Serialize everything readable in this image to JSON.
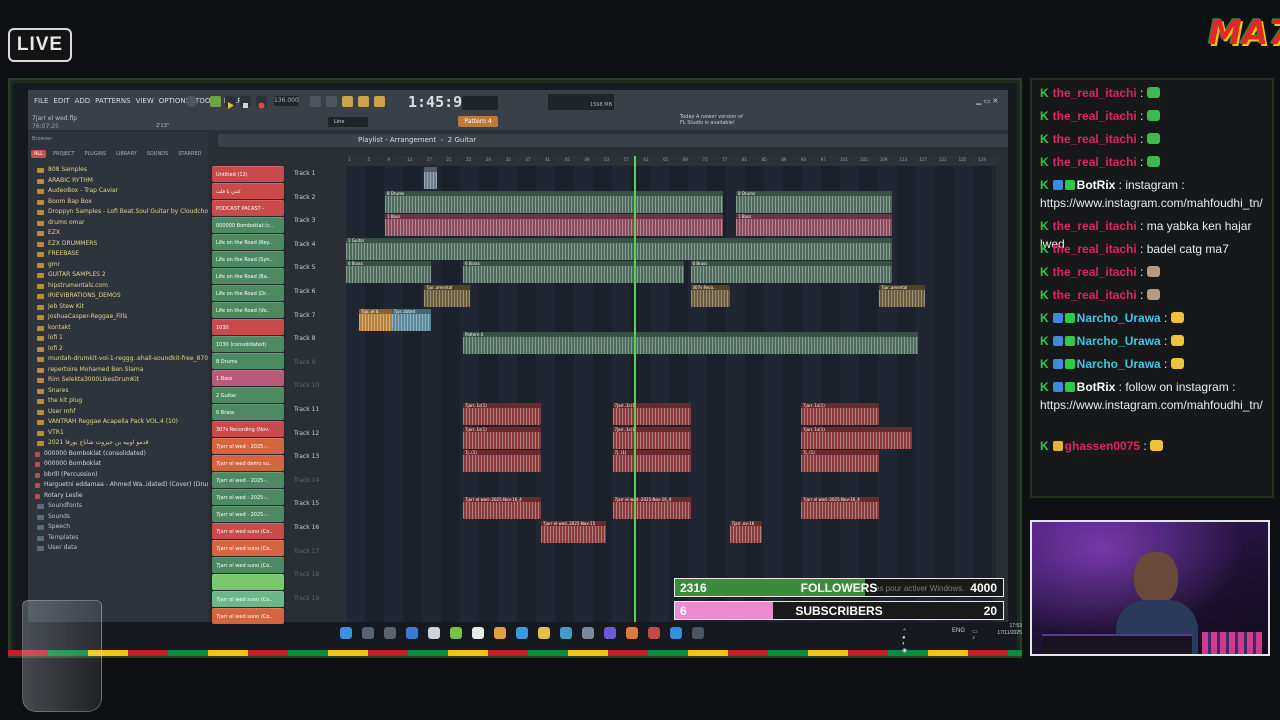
{
  "overlay": {
    "live_label": "LIVE",
    "brand_label": "MA7"
  },
  "fl": {
    "menu": [
      "FILE",
      "EDIT",
      "ADD",
      "PATTERNS",
      "VIEW",
      "OPTIONS",
      "TOOLS",
      "HELP"
    ],
    "file_name": "7jarr el wed.flp",
    "file_time": "76:07:25",
    "file_time_right": "2'13\"",
    "clock": "1:45:97",
    "bpm": "136.000",
    "mode": "Line",
    "pattern_label": "Pattern 4",
    "ram_label": "1598 MB",
    "update_hint": [
      "Today  A newer version of",
      "FL Studio is available!"
    ],
    "browser_label": "Browser",
    "browser_tabs": [
      "ALL",
      "PROJECT",
      "PLUGINS",
      "LIBRARY",
      "SOUNDS",
      "STARRED"
    ],
    "playlist_title": "Playlist - Arrangement",
    "playlist_pattern": "2 Guitar"
  },
  "browser_items": [
    {
      "label": "808 Samples",
      "kind": "folder"
    },
    {
      "label": "ARABIC RYTHM",
      "kind": "folder"
    },
    {
      "label": "AudeoBox - Trap Caviar",
      "kind": "folder"
    },
    {
      "label": "Boom Bap Box",
      "kind": "folder"
    },
    {
      "label": "Droppyn Samples - Lofi Beat.Soul Guitar by Cloudchord",
      "kind": "folder"
    },
    {
      "label": "drums omar",
      "kind": "folder"
    },
    {
      "label": "EZX",
      "kind": "folder"
    },
    {
      "label": "EZX DRUMMERS",
      "kind": "folder"
    },
    {
      "label": "FREEBASE",
      "kind": "folder"
    },
    {
      "label": "gmr",
      "kind": "folder"
    },
    {
      "label": "GUITAR SAMPLES 2",
      "kind": "folder"
    },
    {
      "label": "hipstrumentals.com",
      "kind": "folder"
    },
    {
      "label": "IRIEVIBRATIONS_DEMOS",
      "kind": "folder"
    },
    {
      "label": "Jeb Stew Kit",
      "kind": "folder"
    },
    {
      "label": "JoshuaCasper-Reggae_Fills",
      "kind": "folder"
    },
    {
      "label": "kontakt",
      "kind": "folder"
    },
    {
      "label": "lofi 1",
      "kind": "folder"
    },
    {
      "label": "lofi 2",
      "kind": "folder"
    },
    {
      "label": "murdah-drumkit-vol-1-reggg..ehall-soundkit-free_87024",
      "kind": "folder"
    },
    {
      "label": "repertoire Mohamed Ben Slama",
      "kind": "folder"
    },
    {
      "label": "Rim Selekta3000LikesDrumKit",
      "kind": "folder"
    },
    {
      "label": "Snares",
      "kind": "folder"
    },
    {
      "label": "the kit plug",
      "kind": "folder"
    },
    {
      "label": "User mhf",
      "kind": "folder"
    },
    {
      "label": "VANTRAH Reggae Acapella Pack VOL.4 (10)",
      "kind": "folder"
    },
    {
      "label": "VTR1",
      "kind": "folder"
    },
    {
      "label": "قدمو اوبيه بن جيزوت شاباج يورفا 2021",
      "kind": "folder"
    },
    {
      "label": "000000 Bomboklat (consolidated)",
      "kind": "sub"
    },
    {
      "label": "000000 Bomboklat",
      "kind": "sub"
    },
    {
      "label": "bbrlll (Percussion)",
      "kind": "sub"
    },
    {
      "label": "Harguetni eddamaa - Ahmed Wa..idated) (Cover) (Drums) (1)",
      "kind": "sub"
    },
    {
      "label": "Rotary Leslie",
      "kind": "sub"
    },
    {
      "label": "Soundfonts",
      "kind": "root"
    },
    {
      "label": "Sounds",
      "kind": "root"
    },
    {
      "label": "Speech",
      "kind": "root"
    },
    {
      "label": "Templates",
      "kind": "root"
    },
    {
      "label": "User data",
      "kind": "root"
    }
  ],
  "channels": [
    {
      "label": "Untitled (12)",
      "color": "#c94a4a"
    },
    {
      "label": "كنتي يا قلب",
      "color": "#c94a4a"
    },
    {
      "label": "PODCAST PACAST -",
      "color": "#c94a4a"
    },
    {
      "label": "000000 Bomboklat (c..",
      "color": "#4d8a62"
    },
    {
      "label": "Life on the Road (Key..",
      "color": "#4d8a62"
    },
    {
      "label": "Life on the Road (Syn..",
      "color": "#4d8a62"
    },
    {
      "label": "Life on the Road (Ba..",
      "color": "#4d8a62"
    },
    {
      "label": "Life on the Road (Dr..",
      "color": "#4d8a62"
    },
    {
      "label": "Life on the Road (Vo..",
      "color": "#4d8a62"
    },
    {
      "label": "1030",
      "color": "#c94a4a"
    },
    {
      "label": "1030 (consolidated)",
      "color": "#4d8a62"
    },
    {
      "label": "8 Drums",
      "color": "#4d8a62"
    },
    {
      "label": "1 Bass",
      "color": "#b85a7a"
    },
    {
      "label": "2 Guitar",
      "color": "#4d8a62"
    },
    {
      "label": "6 Brass",
      "color": "#4d8a62"
    },
    {
      "label": "307s Recording (Nov..",
      "color": "#c94a4a"
    },
    {
      "label": "7jarr el wed - 2025-..",
      "color": "#d4653e"
    },
    {
      "label": "7jarr el wed demo su..",
      "color": "#d4653e"
    },
    {
      "label": "7jarr el wed - 2025-..",
      "color": "#4d8a62"
    },
    {
      "label": "7jarr el wed - 2025-..",
      "color": "#4d8a62"
    },
    {
      "label": "7jarr el wed - 2025-..",
      "color": "#4d8a62"
    },
    {
      "label": "7jarr el wed suno (Co..",
      "color": "#c94a4a"
    },
    {
      "label": "7jarr el wed suno (Co..",
      "color": "#d4653e"
    },
    {
      "label": "7jarr el wed suno (Co..",
      "color": "#4d8a62"
    },
    {
      "label": "",
      "color": "#76c86a"
    },
    {
      "label": "7jarr el wed suno (Co..",
      "color": "#6ab88a"
    },
    {
      "label": "7jarr el wed suno (Co..",
      "color": "#d4653e"
    }
  ],
  "tracks": [
    "Track 1",
    "Track 2",
    "Track 3",
    "Track 4",
    "Track 5",
    "Track 6",
    "Track 7",
    "Track 8",
    "Track 9",
    "Track 10",
    "Track 11",
    "Track 12",
    "Track 13",
    "Track 14",
    "Track 15",
    "Track 16",
    "Track 17",
    "Track 18",
    "Track 19"
  ],
  "ruler_ticks": [
    "1",
    "5",
    "9",
    "13",
    "17",
    "21",
    "25",
    "29",
    "33",
    "37",
    "41",
    "45",
    "49",
    "53",
    "57",
    "61",
    "65",
    "69",
    "73",
    "77",
    "81",
    "85",
    "89",
    "93",
    "97",
    "101",
    "105",
    "109",
    "113",
    "117",
    "121",
    "125",
    "129"
  ],
  "clips": [
    {
      "track": 1,
      "start": 0.12,
      "len": 0.02,
      "label": "",
      "color": "#6b7c8a"
    },
    {
      "track": 2,
      "start": 0.06,
      "len": 0.52,
      "label": "8 Drums",
      "color": "#4d6b5c"
    },
    {
      "track": 2,
      "start": 0.6,
      "len": 0.24,
      "label": "8 Drums",
      "color": "#4d6b5c"
    },
    {
      "track": 3,
      "start": 0.06,
      "len": 0.52,
      "label": "1 Bass",
      "color": "#8a4a5c"
    },
    {
      "track": 3,
      "start": 0.6,
      "len": 0.24,
      "label": "1 Bass",
      "color": "#8a4a5c"
    },
    {
      "track": 4,
      "start": 0.0,
      "len": 0.84,
      "label": "2 Guitar",
      "color": "#4d6b5c"
    },
    {
      "track": 5,
      "start": 0.0,
      "len": 0.13,
      "label": "6 Brass",
      "color": "#4d6b5c"
    },
    {
      "track": 5,
      "start": 0.18,
      "len": 0.34,
      "label": "6 Brass",
      "color": "#4d6b5c"
    },
    {
      "track": 5,
      "start": 0.53,
      "len": 0.31,
      "label": "6 Brass",
      "color": "#4d6b5c"
    },
    {
      "track": 6,
      "start": 0.12,
      "len": 0.07,
      "label": "7jar..amental",
      "color": "#6b5a3a"
    },
    {
      "track": 6,
      "start": 0.53,
      "len": 0.06,
      "label": "307s Reco..",
      "color": "#6b5a3a"
    },
    {
      "track": 6,
      "start": 0.82,
      "len": 0.07,
      "label": "7jar..amental",
      "color": "#6b5a3a"
    },
    {
      "track": 7,
      "start": 0.02,
      "len": 0.05,
      "label": "7jar..el d.",
      "color": "#b8803a"
    },
    {
      "track": 7,
      "start": 0.07,
      "len": 0.06,
      "label": "7jar..dated",
      "color": "#5a8a9a"
    },
    {
      "track": 8,
      "start": 0.18,
      "len": 0.7,
      "label": "Pattern 4",
      "color": "#4d6b5c"
    },
    {
      "track": 11,
      "start": 0.18,
      "len": 0.12,
      "label": "7jarr..1s(1)",
      "color": "#8a3a3a"
    },
    {
      "track": 11,
      "start": 0.41,
      "len": 0.12,
      "label": "7jarr..1s(1)",
      "color": "#8a3a3a"
    },
    {
      "track": 11,
      "start": 0.7,
      "len": 0.12,
      "label": "7jarr..1s(1)",
      "color": "#8a3a3a"
    },
    {
      "track": 12,
      "start": 0.18,
      "len": 0.12,
      "label": "7jarr..1s(1)",
      "color": "#8a3a3a"
    },
    {
      "track": 12,
      "start": 0.41,
      "len": 0.12,
      "label": "7jarr..1s(1)",
      "color": "#8a3a3a"
    },
    {
      "track": 12,
      "start": 0.7,
      "len": 0.17,
      "label": "7jarr..1s(1)",
      "color": "#8a3a3a"
    },
    {
      "track": 13,
      "start": 0.18,
      "len": 0.12,
      "label": "7j..(1)",
      "color": "#8a3a3a"
    },
    {
      "track": 13,
      "start": 0.41,
      "len": 0.12,
      "label": "7j..(1)",
      "color": "#8a3a3a"
    },
    {
      "track": 13,
      "start": 0.7,
      "len": 0.12,
      "label": "7j..(1)",
      "color": "#8a3a3a"
    },
    {
      "track": 15,
      "start": 0.18,
      "len": 0.12,
      "label": "7jarr el wed.-2025-Nov-16_4",
      "color": "#8a3a3a"
    },
    {
      "track": 15,
      "start": 0.41,
      "len": 0.12,
      "label": "7jarr el wed.-2025-Nov-16_4",
      "color": "#8a3a3a"
    },
    {
      "track": 15,
      "start": 0.7,
      "len": 0.12,
      "label": "7jarr el wed.-2025-Nov-16_4",
      "color": "#8a3a3a"
    },
    {
      "track": 16,
      "start": 0.3,
      "len": 0.1,
      "label": "7jarr el wed..2025-Nov-15",
      "color": "#8a3a3a"
    },
    {
      "track": 16,
      "start": 0.59,
      "len": 0.05,
      "label": "7jarr..ov-16",
      "color": "#8a3a3a"
    }
  ],
  "stats": {
    "followers_current": "2316",
    "followers_label": "FOLLOWERS",
    "followers_goal": "4000",
    "followers_fraction": 0.579,
    "subscribers_current": "6",
    "subscribers_label": "SUBSCRIBERS",
    "subscribers_goal": "20",
    "subscribers_fraction": 0.3,
    "activation_hint": "es pour activer Windows."
  },
  "taskbar": {
    "lang": "ENG",
    "time": "17:53",
    "date": "17/11/2025"
  },
  "chat": [
    {
      "user": "the_real_itachi",
      "text": " : ",
      "color": "#e0245e",
      "emote": "#3dbb4a"
    },
    {
      "user": "the_real_itachi",
      "text": " : ",
      "color": "#e0245e",
      "emote": "#3dbb4a"
    },
    {
      "user": "the_real_itachi",
      "text": " : ",
      "color": "#e0245e",
      "emote": "#3dbb4a"
    },
    {
      "user": "the_real_itachi",
      "text": " : ",
      "color": "#e0245e",
      "emote": "#3dbb4a"
    },
    {
      "user": "BotRix",
      "text": " : instagram : https://www.instagram.com/mahfoudhi_tn/",
      "color": "#ffffff",
      "emote": ""
    },
    {
      "user": "the_real_itachi",
      "text": " : ma yabka ken hajar lwed",
      "color": "#e0245e",
      "emote": ""
    },
    {
      "user": "the_real_itachi",
      "text": " : badel catg ma7",
      "color": "#e0245e",
      "emote": ""
    },
    {
      "user": "the_real_itachi",
      "text": " : ",
      "color": "#e0245e",
      "emote": "#b59a86"
    },
    {
      "user": "the_real_itachi",
      "text": " : ",
      "color": "#e0245e",
      "emote": "#b59a86"
    },
    {
      "user": "Narcho_Urawa",
      "text": " : ",
      "color": "#3fc6e6",
      "emote": "#f0c23a"
    },
    {
      "user": "Narcho_Urawa",
      "text": " : ",
      "color": "#3fc6e6",
      "emote": "#f0c23a"
    },
    {
      "user": "Narcho_Urawa",
      "text": " : ",
      "color": "#3fc6e6",
      "emote": "#f0c23a"
    },
    {
      "user": "BotRix",
      "text": " : follow on instagram : https://www.instagram.com/mahfoudhi_tn/",
      "color": "#ffffff",
      "emote": ""
    },
    {
      "user": "ghassen0075",
      "text": " : ",
      "color": "#e0245e",
      "emote": "#f0c23a"
    }
  ]
}
